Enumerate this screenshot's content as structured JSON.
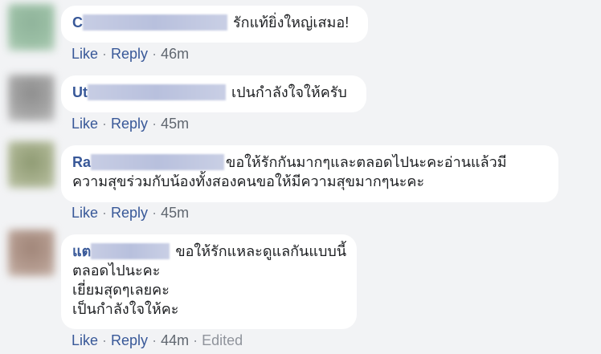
{
  "comments": [
    {
      "author": "C",
      "text_lines": [
        "รักแท้ยิ่งใหญ่เสมอ!"
      ],
      "like": "Like",
      "reply": "Reply",
      "time": "46m",
      "edited": ""
    },
    {
      "author": "Ut",
      "text_lines": [
        "เปนกำลังใจให้ครับ"
      ],
      "like": "Like",
      "reply": "Reply",
      "time": "45m",
      "edited": ""
    },
    {
      "author": "Ra",
      "text_lines": [
        "ขอให้รักกันมากๆและตลอดไปนะคะอ่านแล้วมี",
        "ความสุขร่วมกับน้องทั้งสองคนขอให้มีความสุขมากๆนะคะ"
      ],
      "like": "Like",
      "reply": "Reply",
      "time": "45m",
      "edited": ""
    },
    {
      "author": "แต",
      "text_lines": [
        "ขอให้รักแหละดูแลกันแบบนี้",
        "ตลอดไปนะคะ",
        "เยี่ยมสุดๆเลยคะ",
        "เป็นกำลังใจให้คะ"
      ],
      "like": "Like",
      "reply": "Reply",
      "time": "44m",
      "edited": "Edited"
    }
  ],
  "separator": "·",
  "colors": {
    "background": "#f2f3f5",
    "bubble": "#ffffff",
    "link": "#385898",
    "meta": "#90949c"
  }
}
